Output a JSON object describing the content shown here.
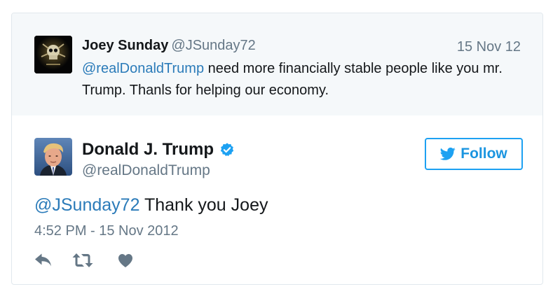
{
  "parent_tweet": {
    "name": "Joey Sunday",
    "handle": "@JSunday72",
    "date": "15 Nov 12",
    "mention": "@realDonaldTrump",
    "text": " need more financially stable people like you mr. Trump. Thanls for helping our economy."
  },
  "tweet": {
    "author_name": "Donald J. Trump",
    "author_handle": "@realDonaldTrump",
    "verified": true,
    "follow_label": "Follow",
    "mention": "@JSunday72",
    "text": " Thank you Joey",
    "timestamp": "4:52 PM - 15 Nov 2012"
  },
  "actions": {
    "icons": [
      "reply-icon",
      "retweet-icon",
      "like-icon"
    ]
  },
  "colors": {
    "link": "#2b7bb9",
    "follow_accent": "#1da1f2",
    "verified": "#1da1f2",
    "muted": "#657786",
    "parent_bg": "#f5f8fa"
  }
}
